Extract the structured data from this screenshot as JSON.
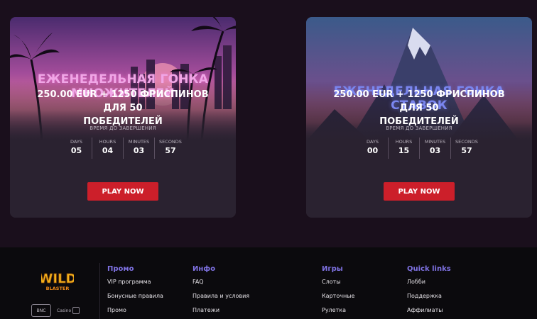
{
  "tournaments": [
    {
      "title_line1": "ЕЖЕНЕДЕЛЬНАЯ ГОНКА",
      "title_line2": "МНОЖИТЕЛЕЙ",
      "prize_line1": "250.00 EUR + 1250 ФРИСПИНОВ ДЛЯ 50",
      "prize_line2": "ПОБЕДИТЕЛЕЙ",
      "timer_label": "ВРЕМЯ ДО ЗАВЕРШЕНИЯ",
      "timer": [
        {
          "label": "DAYS",
          "value": "05"
        },
        {
          "label": "HOURS",
          "value": "04"
        },
        {
          "label": "MINUTES",
          "value": "03"
        },
        {
          "label": "SECONDS",
          "value": "57"
        }
      ],
      "button": "PLAY NOW"
    },
    {
      "title_line1": "ЕЖЕНЕДЕЛЬНАЯ ГОНКА СТАВОК",
      "prize_line1": "250.00 EUR + 1250 ФРИСПИНОВ ДЛЯ 50",
      "prize_line2": "ПОБЕДИТЕЛЕЙ",
      "timer_label": "ВРЕМЯ ДО ЗАВЕРШЕНИЯ",
      "timer": [
        {
          "label": "DAYS",
          "value": "00"
        },
        {
          "label": "HOURS",
          "value": "15"
        },
        {
          "label": "MINUTES",
          "value": "03"
        },
        {
          "label": "SECONDS",
          "value": "57"
        }
      ],
      "button": "PLAY NOW"
    }
  ],
  "footer": {
    "logo_text_top": "WILD",
    "logo_text_bottom": "BLASTER",
    "badges": {
      "bnc": "BNC",
      "casino": "Casino"
    },
    "columns": [
      {
        "heading": "Промо",
        "links": [
          "VIP программа",
          "Бонусные правила",
          "Промо"
        ]
      },
      {
        "heading": "Инфо",
        "links": [
          "FAQ",
          "Правила и условия",
          "Платежи"
        ]
      },
      {
        "heading": "Игры",
        "links": [
          "Слоты",
          "Карточные",
          "Рулетка"
        ]
      },
      {
        "heading": "Quick links",
        "links": [
          "Лобби",
          "Поддержка",
          "Аффилиаты"
        ]
      }
    ]
  },
  "colors": {
    "page_bg": "#1a0f1c",
    "card_bg": "#2a2230",
    "button_red": "#cc1f2a",
    "footer_bg": "#0b0a0d",
    "footer_heading": "#7f72e3",
    "title_pink": "#f0a6e6",
    "title_blue": "#7a86ef"
  }
}
